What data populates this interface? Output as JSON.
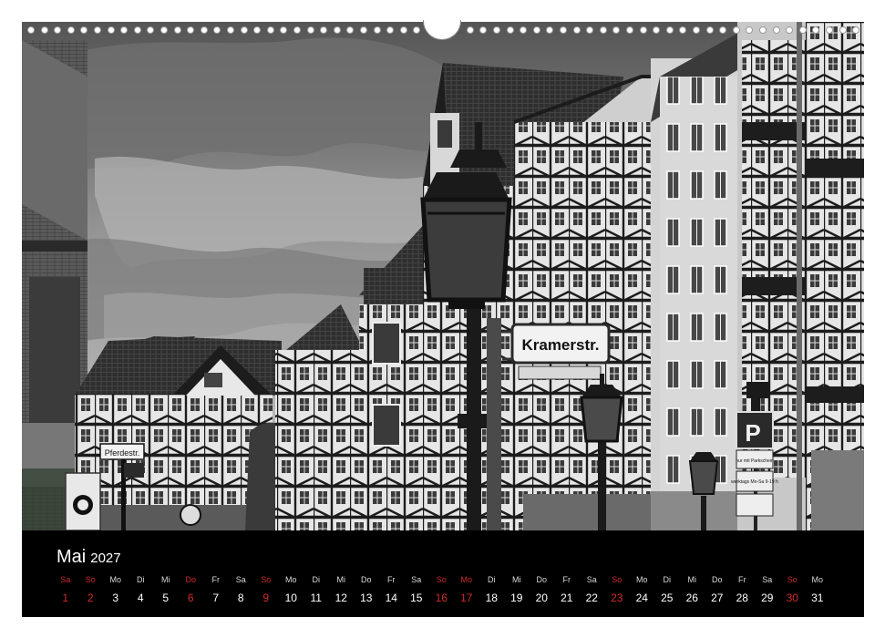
{
  "calendar": {
    "month": "Mai",
    "year": "2027",
    "days": [
      {
        "wd": "Sa",
        "d": "1",
        "holiday": true
      },
      {
        "wd": "So",
        "d": "2",
        "holiday": true
      },
      {
        "wd": "Mo",
        "d": "3",
        "holiday": false
      },
      {
        "wd": "Di",
        "d": "4",
        "holiday": false
      },
      {
        "wd": "Mi",
        "d": "5",
        "holiday": false
      },
      {
        "wd": "Do",
        "d": "6",
        "holiday": true
      },
      {
        "wd": "Fr",
        "d": "7",
        "holiday": false
      },
      {
        "wd": "Sa",
        "d": "8",
        "holiday": false
      },
      {
        "wd": "So",
        "d": "9",
        "holiday": true
      },
      {
        "wd": "Mo",
        "d": "10",
        "holiday": false
      },
      {
        "wd": "Di",
        "d": "11",
        "holiday": false
      },
      {
        "wd": "Mi",
        "d": "12",
        "holiday": false
      },
      {
        "wd": "Do",
        "d": "13",
        "holiday": false
      },
      {
        "wd": "Fr",
        "d": "14",
        "holiday": false
      },
      {
        "wd": "Sa",
        "d": "15",
        "holiday": false
      },
      {
        "wd": "So",
        "d": "16",
        "holiday": true
      },
      {
        "wd": "Mo",
        "d": "17",
        "holiday": true
      },
      {
        "wd": "Di",
        "d": "18",
        "holiday": false
      },
      {
        "wd": "Mi",
        "d": "19",
        "holiday": false
      },
      {
        "wd": "Do",
        "d": "20",
        "holiday": false
      },
      {
        "wd": "Fr",
        "d": "21",
        "holiday": false
      },
      {
        "wd": "Sa",
        "d": "22",
        "holiday": false
      },
      {
        "wd": "So",
        "d": "23",
        "holiday": true
      },
      {
        "wd": "Mo",
        "d": "24",
        "holiday": false
      },
      {
        "wd": "Di",
        "d": "25",
        "holiday": false
      },
      {
        "wd": "Mi",
        "d": "26",
        "holiday": false
      },
      {
        "wd": "Do",
        "d": "27",
        "holiday": false
      },
      {
        "wd": "Fr",
        "d": "28",
        "holiday": false
      },
      {
        "wd": "Sa",
        "d": "29",
        "holiday": false
      },
      {
        "wd": "So",
        "d": "30",
        "holiday": true
      },
      {
        "wd": "Mo",
        "d": "31",
        "holiday": false
      }
    ]
  },
  "photo": {
    "signs": {
      "kramerstr": "Kramerstr.",
      "pferdestr": "Pferdestr.",
      "parking": "P",
      "parking_sub": "nur mit Parkschein",
      "werktags": "werktags Mo-Sa 9-19 h"
    }
  },
  "colors": {
    "calendar_bg": "#000000",
    "text": "#ffffff",
    "holiday": "#d22a2a"
  }
}
